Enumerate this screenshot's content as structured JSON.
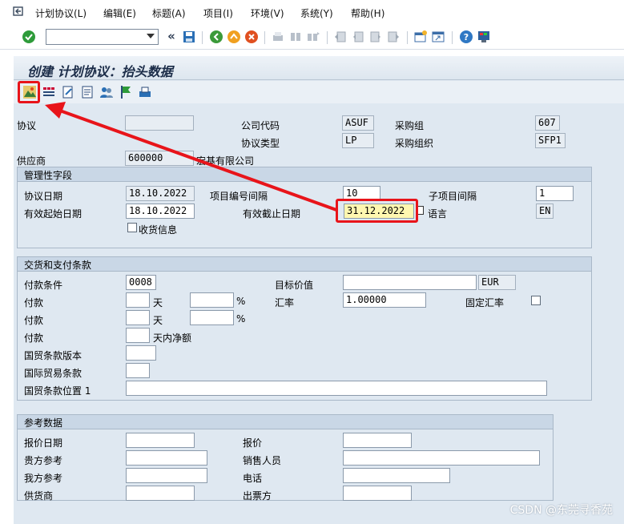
{
  "menu": {
    "items": [
      "计划协议(L)",
      "编辑(E)",
      "标题(A)",
      "项目(I)",
      "环境(V)",
      "系统(Y)",
      "帮助(H)"
    ]
  },
  "toolbar": {
    "command_value": "",
    "back_glyph": "«"
  },
  "header": {
    "title": "创建 计划协议：抬头数据"
  },
  "top_fields": {
    "agreement_label": "协议",
    "agreement_value": "",
    "company_code_label": "公司代码",
    "company_code_value": "ASUF",
    "purch_group_label": "采购组",
    "purch_group_value": "607",
    "agreement_type_label": "协议类型",
    "agreement_type_value": "LP",
    "purch_org_label": "采购组织",
    "purch_org_value": "SFP1",
    "vendor_label": "供应商",
    "vendor_value": "600000",
    "vendor_name": "宏基有限公司"
  },
  "admin": {
    "title": "管理性字段",
    "agreement_date_label": "协议日期",
    "agreement_date_value": "18.10.2022",
    "item_interval_label": "项目编号间隔",
    "item_interval_value": "10",
    "subitem_interval_label": "子项目间隔",
    "subitem_interval_value": "1",
    "valid_from_label": "有效起始日期",
    "valid_from_value": "18.10.2022",
    "valid_to_label": "有效截止日期",
    "valid_to_value": "31.12.2022",
    "language_label": "语言",
    "language_value": "EN",
    "gr_message_label": "收货信息"
  },
  "terms": {
    "title": "交货和支付条款",
    "payment_terms_label": "付款条件",
    "payment_terms_value": "0008",
    "target_value_label": "目标价值",
    "target_value_value": "",
    "currency_value": "EUR",
    "payment1_label": "付款",
    "days_label": "天",
    "percent_label": "%",
    "exchange_rate_label": "汇率",
    "exchange_rate_value": "1.00000",
    "fixed_rate_label": "固定汇率",
    "payment2_label": "付款",
    "payment3_label": "付款",
    "days_net_label": "天内净额",
    "incoterms_version_label": "国贸条款版本",
    "incoterms_label": "国际贸易条款",
    "incoterms_location_label": "国贸条款位置 1"
  },
  "reference": {
    "title": "参考数据",
    "quotation_date_label": "报价日期",
    "quotation_label": "报价",
    "your_ref_label": "贵方参考",
    "salesperson_label": "销售人员",
    "our_ref_label": "我方参考",
    "telephone_label": "电话",
    "supplying_vendor_label": "供货商",
    "invoicing_party_label": "出票方"
  },
  "watermark": "CSDN @东莞寻香苑",
  "colors": {
    "highlight_red": "#e8141a",
    "sap_blue_bg": "#dfe8f1"
  },
  "icons": [
    "undo-icon",
    "enter-check-icon",
    "save-icon",
    "back-icon",
    "exit-icon",
    "cancel-icon",
    "print-icon",
    "find-icon",
    "find-next-icon",
    "first-page-icon",
    "prev-page-icon",
    "next-page-icon",
    "last-page-icon",
    "new-session-icon",
    "shortcut-icon",
    "help-icon",
    "customize-icon",
    "header-conditions-icon",
    "texts-icon",
    "details-icon",
    "notes-icon",
    "partners-icon",
    "flag-icon",
    "print-preview-icon"
  ]
}
